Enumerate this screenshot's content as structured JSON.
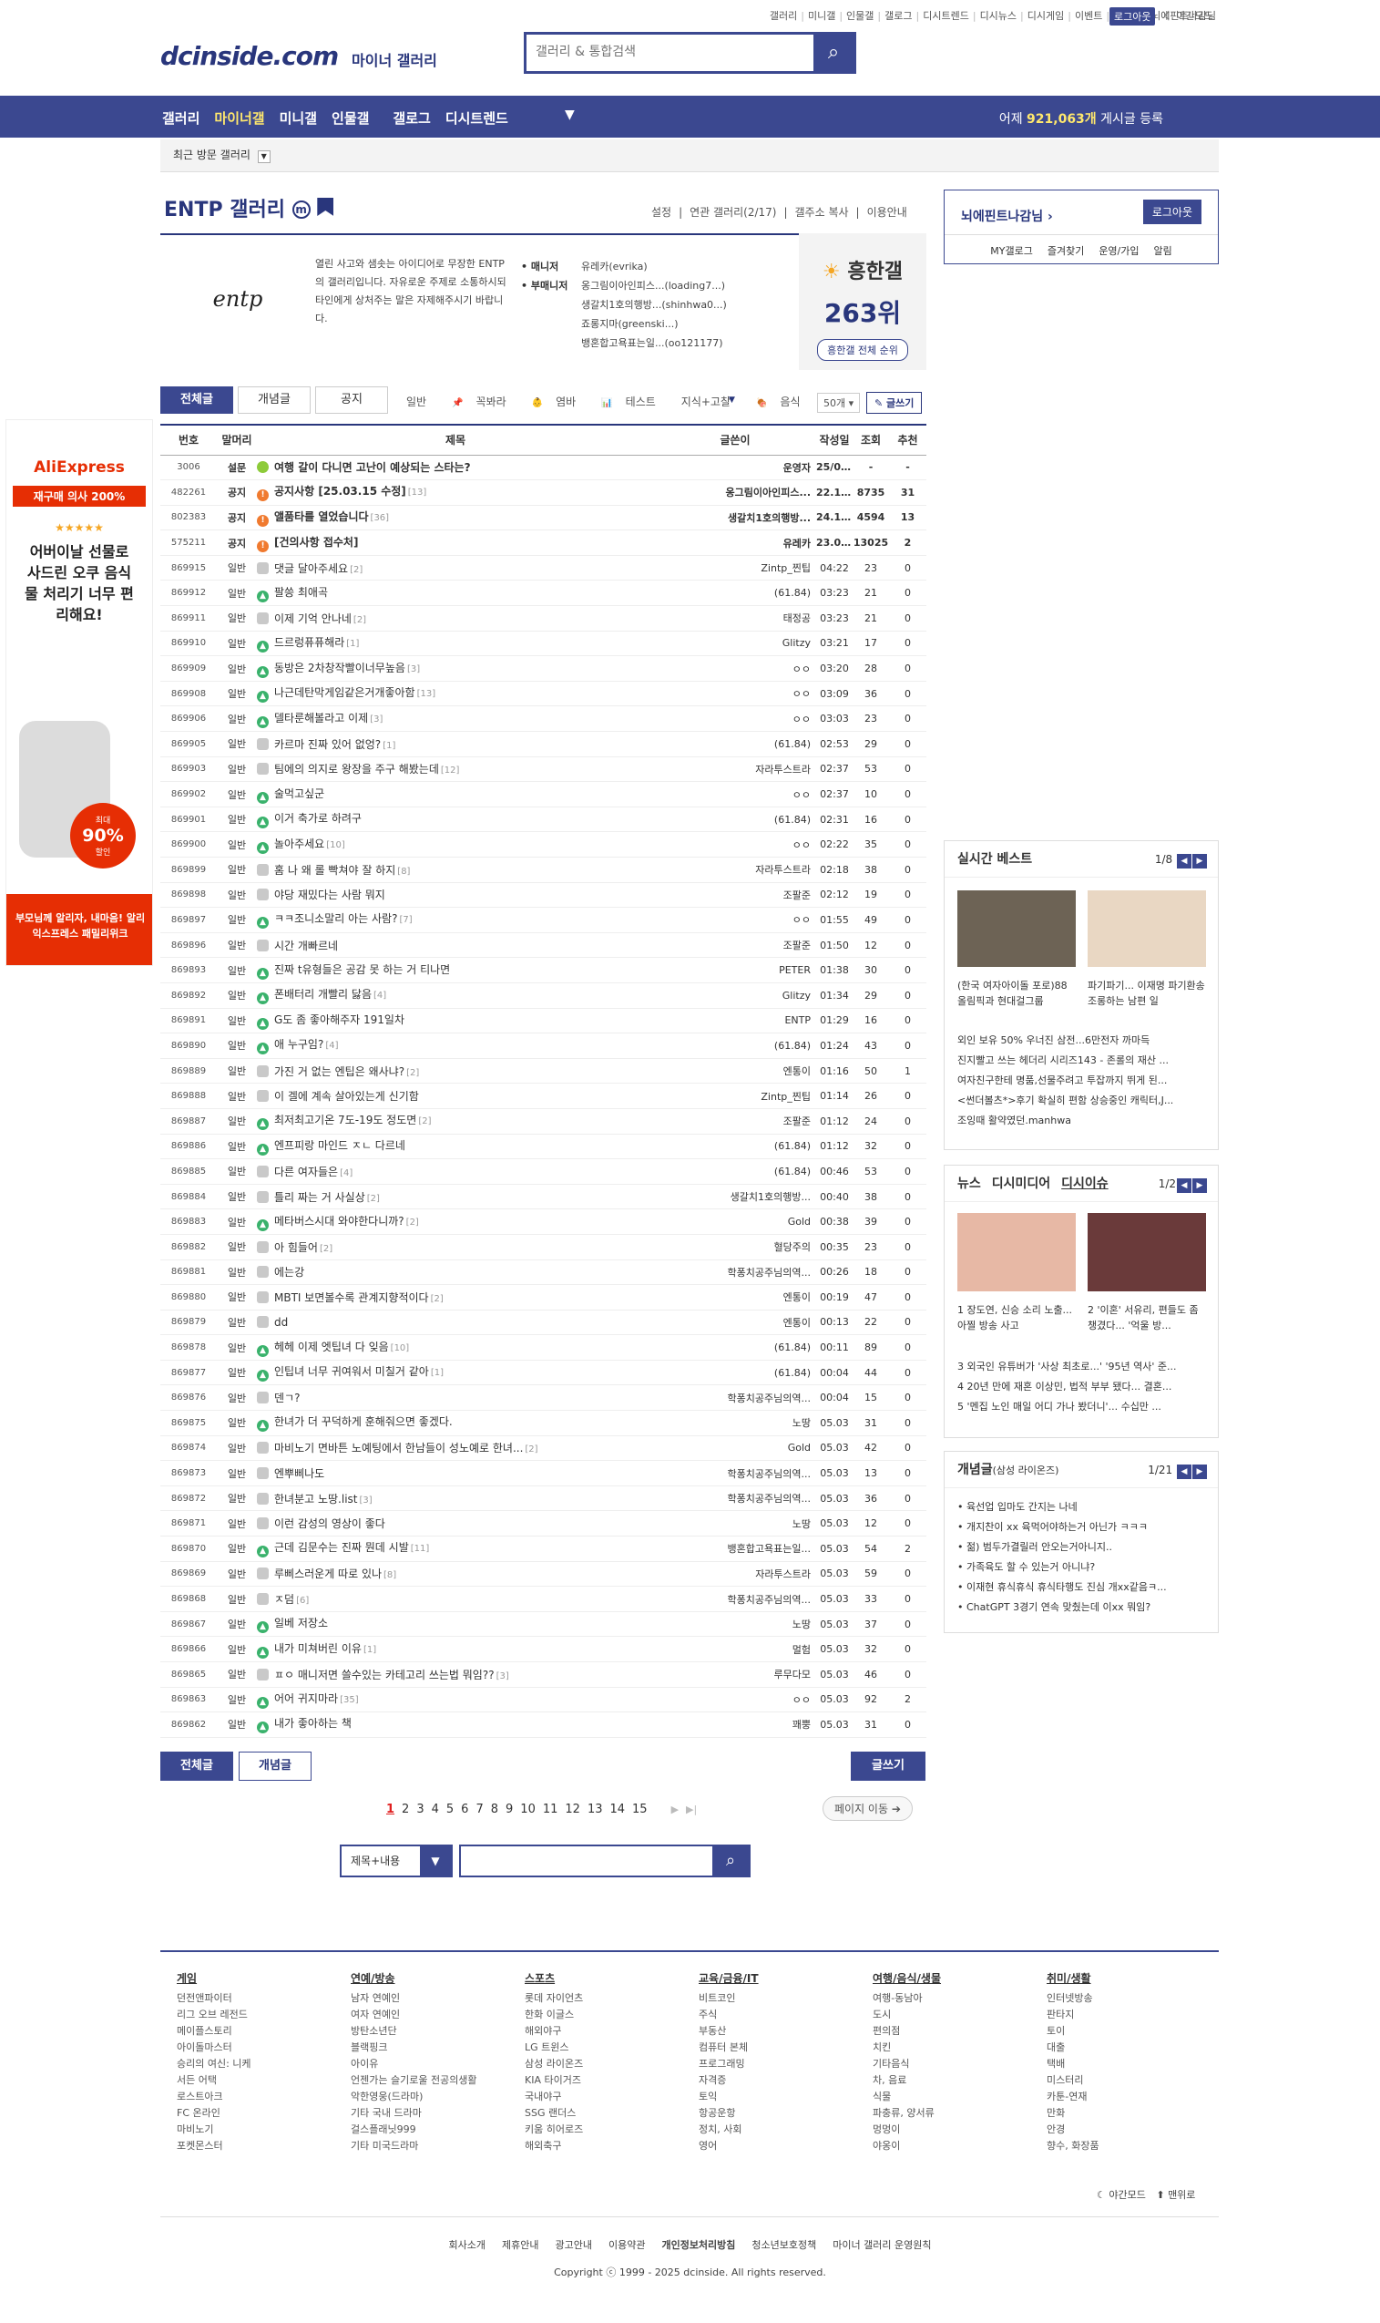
{
  "top_menu": [
    "갤러리",
    "미니갤",
    "인물갤",
    "갤로그",
    "디시트렌드",
    "디시뉴스",
    "디시게임",
    "이벤트",
    "디시콘",
    "뇌에핀트나감님"
  ],
  "top_login": "로그아웃",
  "night_mode": "야간모드",
  "logo": "dcinside.com",
  "logo_sub": "마이너 갤러리",
  "search_placeholder": "갤러리 & 통합검색",
  "gnb": [
    "갤러리",
    "마이너갤",
    "미니갤",
    "인물갤",
    "갤로그",
    "디시트렌드"
  ],
  "gnb_stat_prefix": "어제",
  "gnb_stat_value": "921,063개",
  "gnb_stat_suffix": "게시글 등록",
  "recent_label": "최근 방문 갤러리",
  "gallery_title": "ENTP 갤러리",
  "gallery_settings": [
    "설정",
    "연관 갤러리(2/17)",
    "갤주소 복사",
    "이용안내"
  ],
  "gallery_desc": "열린 사고와 샘솟는 아이디어로 무장한 ENTP의 갤러리입니다. 자유로운 주제로 소통하시되 타인에게 상처주는 말은 자제해주시기 바랍니다.",
  "manager_labels": [
    "• 매니저",
    "• 부매니저"
  ],
  "manager_names": [
    "유레카(evrika)",
    "옹그림이아인피스...(loading7...)",
    "생갈치1호의행방...(shinhwa0...)",
    "죠롱지마(greenski...)",
    "뱅혼합고욕표는일...(oo121177)"
  ],
  "rank_title": "흥한갤",
  "rank_value": "263위",
  "rank_btn": "흥한갤 전체 순위",
  "tabs": [
    "전체글",
    "개념글",
    "공지"
  ],
  "heads": [
    "일반",
    "꼭봐라",
    "염바",
    "테스트",
    "지식+고찰",
    "음식"
  ],
  "list_count": "50개",
  "write_label": "글쓰기",
  "columns": [
    "번호",
    "말머리",
    "제목",
    "글쓴이",
    "작성일",
    "조회",
    "추천"
  ],
  "rows": [
    {
      "n": "3006",
      "h": "설문",
      "t": "여행 갈이 다니면 고난이 예상되는 스타는?",
      "c": "",
      "w": "운영자",
      "d": "25/04/28",
      "v": "-",
      "r": "-",
      "i": "y",
      "notice": true
    },
    {
      "n": "482261",
      "h": "공지",
      "t": "공지사항 [25.03.15 수정]",
      "c": "[13]",
      "w": "옹그림이아인피스...",
      "d": "22.11.13",
      "v": "8735",
      "r": "31",
      "i": "o",
      "notice": true
    },
    {
      "n": "802383",
      "h": "공지",
      "t": "앨품타를 열었습니다",
      "c": "[36]",
      "w": "생갈치1호의행방...",
      "d": "24.10.18",
      "v": "4594",
      "r": "13",
      "i": "o",
      "notice": true
    },
    {
      "n": "575211",
      "h": "공지",
      "t": "[건의사항 접수처]",
      "c": "",
      "w": "유레카",
      "d": "23.04.05",
      "v": "13025",
      "r": "2",
      "i": "o",
      "notice": true
    },
    {
      "n": "869915",
      "h": "일반",
      "t": "댓글 달아주세요",
      "c": "[2]",
      "w": "Zintp_찐팁",
      "d": "04:22",
      "v": "23",
      "r": "0",
      "i": "c"
    },
    {
      "n": "869912",
      "h": "일반",
      "t": "팔씅 최애곡",
      "c": "",
      "w": "(61.84)",
      "d": "03:23",
      "v": "21",
      "r": "0",
      "i": "g"
    },
    {
      "n": "869911",
      "h": "일반",
      "t": "이제 기억 안나네",
      "c": "[2]",
      "w": "태정공",
      "d": "03:23",
      "v": "21",
      "r": "0",
      "i": "c"
    },
    {
      "n": "869910",
      "h": "일반",
      "t": "드르렁퓨퓨해라",
      "c": "[1]",
      "w": "Glitzy",
      "d": "03:21",
      "v": "17",
      "r": "0",
      "i": "g"
    },
    {
      "n": "869909",
      "h": "일반",
      "t": "동방은 2차창작빨이너무높음",
      "c": "[3]",
      "w": "ㅇㅇ",
      "d": "03:20",
      "v": "28",
      "r": "0",
      "i": "g"
    },
    {
      "n": "869908",
      "h": "일반",
      "t": "나근데탄막게임같은거개좋아함",
      "c": "[13]",
      "w": "ㅇㅇ",
      "d": "03:09",
      "v": "36",
      "r": "0",
      "i": "g"
    },
    {
      "n": "869906",
      "h": "일반",
      "t": "델타룬해볼라고 이제",
      "c": "[3]",
      "w": "ㅇㅇ",
      "d": "03:03",
      "v": "23",
      "r": "0",
      "i": "g"
    },
    {
      "n": "869905",
      "h": "일반",
      "t": "카르마 진짜 있어 없엉?",
      "c": "[1]",
      "w": "(61.84)",
      "d": "02:53",
      "v": "29",
      "r": "0",
      "i": "c"
    },
    {
      "n": "869903",
      "h": "일반",
      "t": "팀에의 의지로 왕장을 주구 해봤는데",
      "c": "[12]",
      "w": "자라투스트라",
      "d": "02:37",
      "v": "53",
      "r": "0",
      "i": "c"
    },
    {
      "n": "869902",
      "h": "일반",
      "t": "술먹고싶군",
      "c": "",
      "w": "ㅇㅇ",
      "d": "02:37",
      "v": "10",
      "r": "0",
      "i": "g"
    },
    {
      "n": "869901",
      "h": "일반",
      "t": "이거 축가로 하려구",
      "c": "",
      "w": "(61.84)",
      "d": "02:31",
      "v": "16",
      "r": "0",
      "i": "g"
    },
    {
      "n": "869900",
      "h": "일반",
      "t": "놀아주세요",
      "c": "[10]",
      "w": "ㅇㅇ",
      "d": "02:22",
      "v": "35",
      "r": "0",
      "i": "g"
    },
    {
      "n": "869899",
      "h": "일반",
      "t": "홈 나 왜 롤 빡쳐야 잘 하지",
      "c": "[8]",
      "w": "자라투스트라",
      "d": "02:18",
      "v": "38",
      "r": "0",
      "i": "c"
    },
    {
      "n": "869898",
      "h": "일반",
      "t": "야당 재밌다는 사람 뭐지",
      "c": "",
      "w": "조팔준",
      "d": "02:12",
      "v": "19",
      "r": "0",
      "i": "c"
    },
    {
      "n": "869897",
      "h": "일반",
      "t": "ㅋㅋ조니소말리 아는 사람?",
      "c": "[7]",
      "w": "ㅇㅇ",
      "d": "01:55",
      "v": "49",
      "r": "0",
      "i": "g"
    },
    {
      "n": "869896",
      "h": "일반",
      "t": "시간 개빠르네",
      "c": "",
      "w": "조팔준",
      "d": "01:50",
      "v": "12",
      "r": "0",
      "i": "c"
    },
    {
      "n": "869893",
      "h": "일반",
      "t": "진짜 t유형들은 공감 못 하는 거 티나면",
      "c": "",
      "w": "PETER",
      "d": "01:38",
      "v": "30",
      "r": "0",
      "i": "g"
    },
    {
      "n": "869892",
      "h": "일반",
      "t": "폰배터리 개빨리 닳음",
      "c": "[4]",
      "w": "Glitzy",
      "d": "01:34",
      "v": "29",
      "r": "0",
      "i": "g"
    },
    {
      "n": "869891",
      "h": "일반",
      "t": "G도 좀 좋아해주자 191일차",
      "c": "",
      "w": "ENTP",
      "d": "01:29",
      "v": "16",
      "r": "0",
      "i": "g"
    },
    {
      "n": "869890",
      "h": "일반",
      "t": "애 누구임?",
      "c": "[4]",
      "w": "(61.84)",
      "d": "01:24",
      "v": "43",
      "r": "0",
      "i": "g"
    },
    {
      "n": "869889",
      "h": "일반",
      "t": "가진 거 없는 엔팁은 왜사냐?",
      "c": "[2]",
      "w": "엔통이",
      "d": "01:16",
      "v": "50",
      "r": "1",
      "i": "c"
    },
    {
      "n": "869888",
      "h": "일반",
      "t": "이 겔에 계속 살아있는게 신기함",
      "c": "",
      "w": "Zintp_찐팁",
      "d": "01:14",
      "v": "26",
      "r": "0",
      "i": "c"
    },
    {
      "n": "869887",
      "h": "일반",
      "t": "최저최고기온 7도-19도 정도면",
      "c": "[2]",
      "w": "조팔준",
      "d": "01:12",
      "v": "24",
      "r": "0",
      "i": "g"
    },
    {
      "n": "869886",
      "h": "일반",
      "t": "엔프피랑 마인드 ㅈㄴ 다르네",
      "c": "",
      "w": "(61.84)",
      "d": "01:12",
      "v": "32",
      "r": "0",
      "i": "g"
    },
    {
      "n": "869885",
      "h": "일반",
      "t": "다른 여자들은",
      "c": "[4]",
      "w": "(61.84)",
      "d": "00:46",
      "v": "53",
      "r": "0",
      "i": "c"
    },
    {
      "n": "869884",
      "h": "일반",
      "t": "틀리 짜는 거 사실상",
      "c": "[2]",
      "w": "생갈치1호의행방...",
      "d": "00:40",
      "v": "38",
      "r": "0",
      "i": "c"
    },
    {
      "n": "869883",
      "h": "일반",
      "t": "메타버스시대 와야한다니까?",
      "c": "[2]",
      "w": "Gold",
      "d": "00:38",
      "v": "39",
      "r": "0",
      "i": "g"
    },
    {
      "n": "869882",
      "h": "일반",
      "t": "아 힘들어",
      "c": "[2]",
      "w": "혈당주의",
      "d": "00:35",
      "v": "23",
      "r": "0",
      "i": "c"
    },
    {
      "n": "869881",
      "h": "일반",
      "t": "에는강",
      "c": "",
      "w": "학퐁치공주님의역...",
      "d": "00:26",
      "v": "18",
      "r": "0",
      "i": "c"
    },
    {
      "n": "869880",
      "h": "일반",
      "t": "MBTI 보면볼수록 관계지향적이다",
      "c": "[2]",
      "w": "엔통이",
      "d": "00:19",
      "v": "47",
      "r": "0",
      "i": "c"
    },
    {
      "n": "869879",
      "h": "일반",
      "t": "dd",
      "c": "",
      "w": "엔통이",
      "d": "00:13",
      "v": "22",
      "r": "0",
      "i": "c"
    },
    {
      "n": "869878",
      "h": "일반",
      "t": "헤헤 이제 엣팁녀 다 잊음",
      "c": "[10]",
      "w": "(61.84)",
      "d": "00:11",
      "v": "89",
      "r": "0",
      "i": "g"
    },
    {
      "n": "869877",
      "h": "일반",
      "t": "인팁녀 너무 귀여워서 미칠거 같아",
      "c": "[1]",
      "w": "(61.84)",
      "d": "00:04",
      "v": "44",
      "r": "0",
      "i": "g"
    },
    {
      "n": "869876",
      "h": "일반",
      "t": "덴ㄱ?",
      "c": "",
      "w": "학퐁치공주님의역...",
      "d": "00:04",
      "v": "15",
      "r": "0",
      "i": "c"
    },
    {
      "n": "869875",
      "h": "일반",
      "t": "한녀가 더 꾸덕하게 훈해줘으면 좋겠다.",
      "c": "",
      "w": "노땅",
      "d": "05.03",
      "v": "31",
      "r": "0",
      "i": "g"
    },
    {
      "n": "869874",
      "h": "일반",
      "t": "마비노기 면바튼 노예팅에서 한남들이 성노예로 한녀...",
      "c": "[2]",
      "w": "Gold",
      "d": "05.03",
      "v": "42",
      "r": "0",
      "i": "c"
    },
    {
      "n": "869873",
      "h": "일반",
      "t": "엔뿌삐나도",
      "c": "",
      "w": "학퐁치공주님의역...",
      "d": "05.03",
      "v": "13",
      "r": "0",
      "i": "c"
    },
    {
      "n": "869872",
      "h": "일반",
      "t": "한녀분고 노땅.list",
      "c": "[3]",
      "w": "학퐁치공주님의역...",
      "d": "05.03",
      "v": "36",
      "r": "0",
      "i": "c"
    },
    {
      "n": "869871",
      "h": "일반",
      "t": "이런 감성의 영상이 좋다",
      "c": "",
      "w": "노땅",
      "d": "05.03",
      "v": "12",
      "r": "0",
      "i": "c"
    },
    {
      "n": "869870",
      "h": "일반",
      "t": "근데 김문수는 진짜 뭔데 시발",
      "c": "[11]",
      "w": "뱅혼합고욕표는일...",
      "d": "05.03",
      "v": "54",
      "r": "2",
      "i": "g"
    },
    {
      "n": "869869",
      "h": "일반",
      "t": "루삐스러운게 따로 있나",
      "c": "[8]",
      "w": "자라투스트라",
      "d": "05.03",
      "v": "59",
      "r": "0",
      "i": "c"
    },
    {
      "n": "869868",
      "h": "일반",
      "t": "ㅈ덤",
      "c": "[6]",
      "w": "학퐁치공주님의역...",
      "d": "05.03",
      "v": "33",
      "r": "0",
      "i": "c"
    },
    {
      "n": "869867",
      "h": "일반",
      "t": "일베 저장소",
      "c": "",
      "w": "노땅",
      "d": "05.03",
      "v": "37",
      "r": "0",
      "i": "g"
    },
    {
      "n": "869866",
      "h": "일반",
      "t": "내가 미쳐버린 이유",
      "c": "[1]",
      "w": "멀험",
      "d": "05.03",
      "v": "32",
      "r": "0",
      "i": "g"
    },
    {
      "n": "869865",
      "h": "일반",
      "t": "ㅍㅇ 매니저면 쓸수있는 카테고리 쓰는법 뭐임??",
      "c": "[3]",
      "w": "루무다모",
      "d": "05.03",
      "v": "46",
      "r": "0",
      "i": "c"
    },
    {
      "n": "869863",
      "h": "일반",
      "t": "어어 귀지마라",
      "c": "[35]",
      "w": "ㅇㅇ",
      "d": "05.03",
      "v": "92",
      "r": "2",
      "i": "g"
    },
    {
      "n": "869862",
      "h": "일반",
      "t": "내가 좋아하는 책",
      "c": "",
      "w": "꽤뿡",
      "d": "05.03",
      "v": "31",
      "r": "0",
      "i": "g"
    }
  ],
  "bottom_buttons": {
    "all": "전체글",
    "concept": "개념글",
    "write": "글쓰기"
  },
  "pages": [
    "1",
    "2",
    "3",
    "4",
    "5",
    "6",
    "7",
    "8",
    "9",
    "10",
    "11",
    "12",
    "13",
    "14",
    "15"
  ],
  "page_jump": "페이지 이동",
  "search_type": "제목+내용",
  "login": {
    "name": "뇌에핀트나감님",
    "logout": "로그아웃",
    "links": [
      "MY갤로그",
      "즐겨찾기",
      "운영/가입",
      "알림"
    ]
  },
  "best": {
    "title": "실시간 베스트",
    "page": "1/8",
    "captions": [
      "(한국 여자아이돌 포로)88올림픽과 현대걸그룹",
      "파기파기... 이재명 파기환송 조롱하는 남편 일"
    ],
    "items": [
      "외인 보유 50% 우너진 삼전...6만전자 까마득",
      "진지빨고 쓰는 헤더리 시리즈143 - 존롤의 재산 ...",
      "여자친구한테 명품,선물주려고 투잡까지 뛰게 된...",
      "<썬더볼츠*>후기 확실히 편함 상승중인 캐릭터,J...",
      "조잉때 활약였던.manhwa"
    ]
  },
  "news": {
    "tabs": [
      "뉴스",
      "디시미디어",
      "디시이슈"
    ],
    "page": "1/2",
    "captions": [
      "1 장도연, 신승 소리 노출... 아찔 방송 사고",
      "2 '이혼' 서유리, 편들도 좀 챙겼다... '억울 방..."
    ],
    "items": [
      "3 외국인 유튜버가 '사상 최초로...' '95년 역사' 준...",
      "4 20년 만에 재혼 이상민, 법적 부부 됐다... 결혼...",
      "5 '멘집 노인 매일 어디 가나 봤더니'... 수십만 ..."
    ]
  },
  "concept": {
    "title": "개념글",
    "sub": "(삼성 라이온즈)",
    "page": "1/21",
    "items": [
      "• 육선업 입마도 간지는 나네",
      "• 개지찬이 xx 육먹어야하는거 아닌가 ㅋㅋㅋ",
      "• 젊) 범두가결릴러 안오는거아니지..",
      "• 가족육도 할 수 있는거 아니냐?",
      "• 이재현 휴식휴식 휴식타행도 진심 개xx같음ㅋ...",
      "• ChatGPT 3경기 연속 맞췄는데 이xx 뭐임?"
    ]
  },
  "ad": {
    "brand": "AliExpress",
    "badge": "재구매 의사 200%",
    "stars": "★★★★★",
    "copy": "어버이날 선물로 사드린 오쿠 음식물 처리기 너무 편리해요!",
    "pct_label": "최대",
    "pct": "90%",
    "pct_suffix": "할인",
    "foot": "부모님께 알리자, 내마음! 알리익스프레스 패밀리위크"
  },
  "footer": {
    "cols": [
      {
        "h": "게임",
        "items": [
          "던전앤파이터",
          "리그 오브 레전드",
          "메이플스토리",
          "아이돌마스터",
          "승리의 여신: 니케",
          "서든 어택",
          "로스트아크",
          "FC 온라인",
          "마비노기",
          "포켓몬스터"
        ]
      },
      {
        "h": "연예/방송",
        "items": [
          "남자 연예인",
          "여자 연예인",
          "방탄소년단",
          "블랙핑크",
          "아이유",
          "언젠가는 슬기로울 전공의생활",
          "악한영웅(드라마)",
          "기타 국내 드라마",
          "걸스플래닛999",
          "기타 미국드라마"
        ]
      },
      {
        "h": "스포츠",
        "items": [
          "롯데 자이언츠",
          "한화 이글스",
          "해외야구",
          "LG 트윈스",
          "삼성 라이온즈",
          "KIA 타이거즈",
          "국내야구",
          "SSG 랜더스",
          "키움 히어로즈",
          "해외축구"
        ]
      },
      {
        "h": "교육/금융/IT",
        "items": [
          "비트코인",
          "주식",
          "부동산",
          "컴퓨터 본체",
          "프로그래밍",
          "자격증",
          "토익",
          "항공운항",
          "정치, 사회",
          "영어"
        ]
      },
      {
        "h": "여행/음식/생물",
        "items": [
          "여행-동남아",
          "도시",
          "편의점",
          "치킨",
          "기타음식",
          "차, 음료",
          "식물",
          "파충류, 양서류",
          "멍멍이",
          "야옹이"
        ]
      },
      {
        "h": "취미/생활",
        "items": [
          "인터넷방송",
          "판타지",
          "토이",
          "대출",
          "택배",
          "미스터리",
          "카툰-연재",
          "만화",
          "안경",
          "향수, 화장품"
        ]
      }
    ],
    "mode": [
      "야간모드",
      "맨위로"
    ],
    "links": [
      "회사소개",
      "제휴안내",
      "광고안내",
      "이용약관",
      "개인정보처리방침",
      "청소년보호정책",
      "마이너 갤러리 운영원칙"
    ],
    "copyright": "Copyright ⓒ 1999 - 2025 dcinside. All rights reserved."
  }
}
